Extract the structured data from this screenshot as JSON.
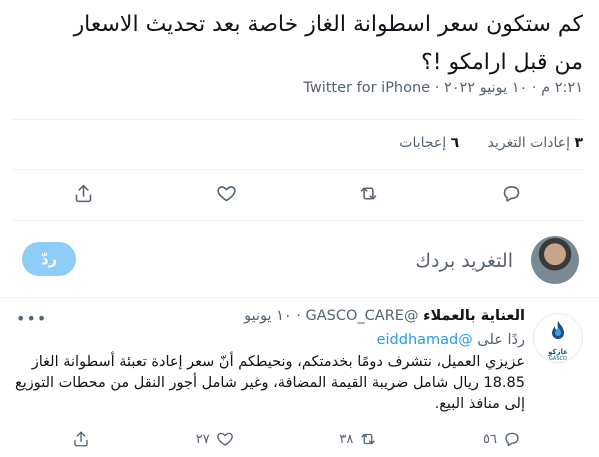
{
  "tweet": {
    "text_line1": "كم ستكون سعر اسطوانة الغاز  خاصة بعد تحديث الاسعار",
    "text_line2": "من قبل ارامكو !؟",
    "timestamp": "٢:٢١ م · ١٠ يونيو ٢٠٢٢",
    "separator": " · ",
    "source": "Twitter for iPhone"
  },
  "stats": {
    "retweets_count": "٣",
    "retweets_label": "إعادات التغريد",
    "likes_count": "٦",
    "likes_label": "إعجابات"
  },
  "composer": {
    "placeholder": "التغريد بردك",
    "reply_button": "ردّ"
  },
  "reply_tweet": {
    "author_name": "العناية بالعملاء",
    "handle": "@GASCO_CARE",
    "dot": "·",
    "date": "١٠ يونيو",
    "replying_to_prefix": "ردًا على",
    "replying_to_handle": "@eiddhamad",
    "text": "عزيزي العميل، نتشرف دومًا بخدمتكم، ونحيطكم أنّ سعر إعادة تعبئة أسطوانة الغاز 18.85 ريال شامل ضريبة القيمة المضافة، وغير شامل أجور النقل من محطات التوزيع إلى منافذ البيع.",
    "logo_text": "غازكو",
    "logo_subtext": "GASCO",
    "replies_count": "٥٦",
    "retweets_count": "٣٨",
    "likes_count": "٢٧",
    "more_icon": "•••"
  }
}
